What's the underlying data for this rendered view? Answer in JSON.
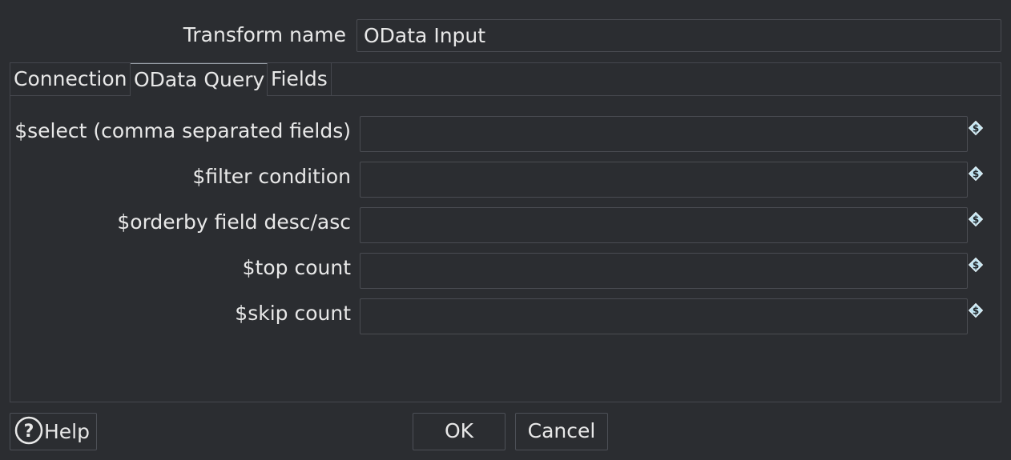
{
  "transform": {
    "name_label": "Transform name",
    "name_value": "OData Input"
  },
  "tabs": [
    {
      "label": "Connection",
      "selected": false
    },
    {
      "label": "OData Query",
      "selected": true
    },
    {
      "label": "Fields",
      "selected": false
    }
  ],
  "query": {
    "select": {
      "label": "$select (comma separated fields)",
      "value": ""
    },
    "filter": {
      "label": "$filter condition",
      "value": ""
    },
    "orderby": {
      "label": "$orderby field desc/asc",
      "value": ""
    },
    "top": {
      "label": "$top count",
      "value": ""
    },
    "skip": {
      "label": "$skip count",
      "value": ""
    }
  },
  "icons": {
    "variable": "dollar-diamond-icon",
    "help": "question-circle-icon"
  },
  "buttons": {
    "help_label": "Help",
    "ok_label": "OK",
    "cancel_label": "Cancel"
  },
  "colors": {
    "background": "#2b2d31",
    "border": "#4a4c52",
    "text": "#e8e8e8",
    "variable_icon": "#bfe3f0"
  }
}
